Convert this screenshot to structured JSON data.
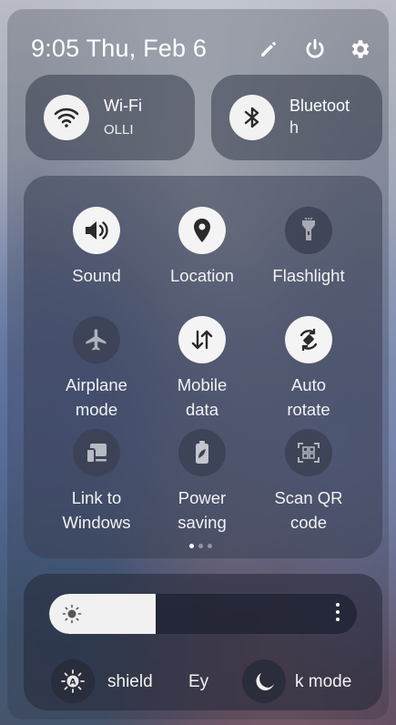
{
  "header": {
    "time": "9:05",
    "date": "Thu, Feb 6",
    "icons": [
      "edit-icon",
      "power-icon",
      "settings-icon"
    ]
  },
  "tiles": {
    "wifi": {
      "title": "Wi-Fi",
      "subtitle": "OLLI",
      "icon": "wifi-icon",
      "state": "on"
    },
    "bluetooth": {
      "title": "Bluetoot",
      "title_wrap": "h",
      "icon": "bluetooth-icon",
      "state": "on"
    }
  },
  "quick_settings": [
    {
      "label_1": "Sound",
      "label_2": "",
      "icon": "volume-icon",
      "state": "on"
    },
    {
      "label_1": "Location",
      "label_2": "",
      "icon": "location-pin-icon",
      "state": "on"
    },
    {
      "label_1": "Flashlight",
      "label_2": "",
      "icon": "flashlight-icon",
      "state": "off"
    },
    {
      "label_1": "Airplane",
      "label_2": "mode",
      "icon": "airplane-icon",
      "state": "off"
    },
    {
      "label_1": "Mobile",
      "label_2": "data",
      "icon": "mobile-data-icon",
      "state": "on"
    },
    {
      "label_1": "Auto",
      "label_2": "rotate",
      "icon": "auto-rotate-icon",
      "state": "on"
    },
    {
      "label_1": "Link to",
      "label_2": "Windows",
      "icon": "link-to-windows-icon",
      "state": "off"
    },
    {
      "label_1": "Power",
      "label_2": "saving",
      "icon": "power-saving-icon",
      "state": "off"
    },
    {
      "label_1": "Scan QR",
      "label_2": "code",
      "icon": "qr-scan-icon",
      "state": "off"
    }
  ],
  "pager": {
    "pages": 3,
    "active": 1
  },
  "brightness": {
    "level_fraction": 0.345,
    "icon": "sun-icon",
    "more_icon": "more-vertical-icon"
  },
  "bottom": {
    "eye_comfort_fragment_a": "shield",
    "eye_comfort_fragment_b": "Ey",
    "dark_mode_fragment": "k mode",
    "icons": [
      "auto-brightness-icon",
      "moon-icon"
    ]
  },
  "colors": {
    "tile_on": "#f2f2f2",
    "icon_on": "#2a2a2a",
    "text": "#ffffff"
  }
}
